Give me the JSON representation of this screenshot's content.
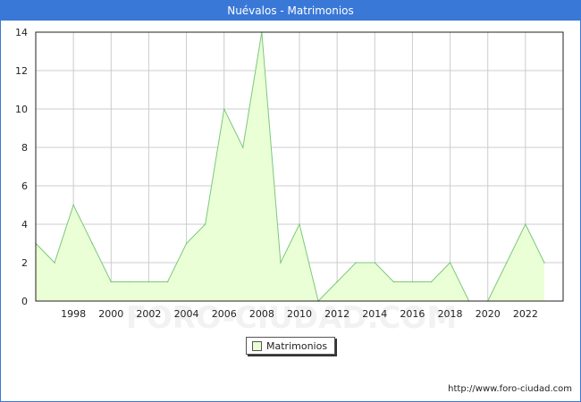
{
  "page": {
    "title": "Nuévalos - Matrimonios",
    "url": "http://www.foro-ciudad.com",
    "watermark": "FORO-CIUDAD.COM"
  },
  "chart_data": {
    "type": "area",
    "title": "Nuévalos - Matrimonios",
    "xlabel": "",
    "ylabel": "",
    "x": [
      1996,
      1997,
      1998,
      1999,
      2000,
      2001,
      2002,
      2003,
      2004,
      2005,
      2006,
      2007,
      2008,
      2009,
      2010,
      2011,
      2012,
      2013,
      2014,
      2015,
      2016,
      2017,
      2018,
      2019,
      2020,
      2021,
      2022,
      2023
    ],
    "series": [
      {
        "name": "Matrimonios",
        "values": [
          3,
          2,
          5,
          3,
          1,
          1,
          1,
          1,
          3,
          4,
          10,
          8,
          14,
          2,
          4,
          0,
          1,
          2,
          2,
          1,
          1,
          1,
          2,
          0,
          0,
          2,
          4,
          2
        ]
      }
    ],
    "xlim": [
      1996,
      2024
    ],
    "ylim": [
      0,
      14
    ],
    "xticks": [
      1998,
      2000,
      2002,
      2004,
      2006,
      2008,
      2010,
      2012,
      2014,
      2016,
      2018,
      2020,
      2022
    ],
    "yticks": [
      0,
      2,
      4,
      6,
      8,
      10,
      12,
      14
    ],
    "grid": true,
    "legend": "bottom-center",
    "colors": {
      "fill": "#eaffd5",
      "line": "#7cc87c",
      "grid": "#cccccc",
      "title_bar": "#3a78d8"
    }
  }
}
